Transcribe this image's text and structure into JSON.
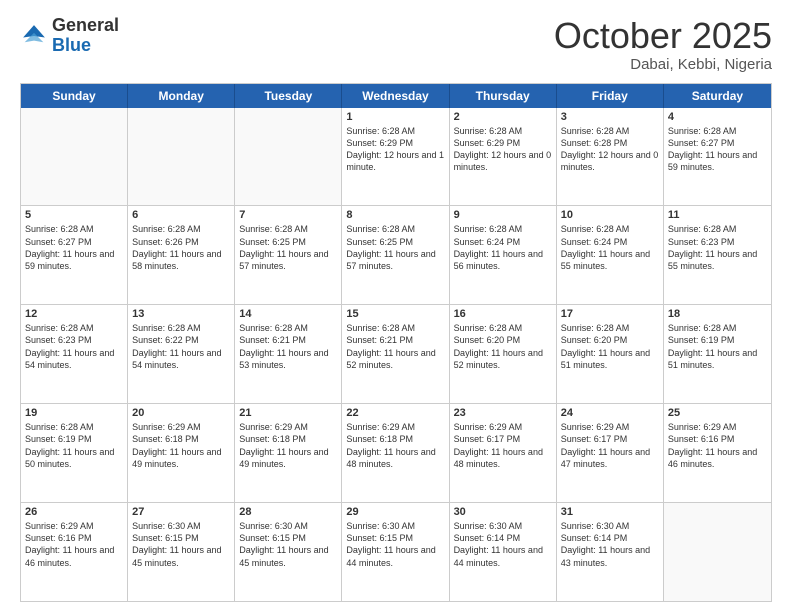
{
  "header": {
    "logo_general": "General",
    "logo_blue": "Blue",
    "month": "October 2025",
    "location": "Dabai, Kebbi, Nigeria"
  },
  "days_of_week": [
    "Sunday",
    "Monday",
    "Tuesday",
    "Wednesday",
    "Thursday",
    "Friday",
    "Saturday"
  ],
  "weeks": [
    [
      {
        "day": "",
        "empty": true
      },
      {
        "day": "",
        "empty": true
      },
      {
        "day": "",
        "empty": true
      },
      {
        "day": "1",
        "sunrise": "6:28 AM",
        "sunset": "6:29 PM",
        "daylight": "12 hours and 1 minute."
      },
      {
        "day": "2",
        "sunrise": "6:28 AM",
        "sunset": "6:29 PM",
        "daylight": "12 hours and 0 minutes."
      },
      {
        "day": "3",
        "sunrise": "6:28 AM",
        "sunset": "6:28 PM",
        "daylight": "12 hours and 0 minutes."
      },
      {
        "day": "4",
        "sunrise": "6:28 AM",
        "sunset": "6:27 PM",
        "daylight": "11 hours and 59 minutes."
      }
    ],
    [
      {
        "day": "5",
        "sunrise": "6:28 AM",
        "sunset": "6:27 PM",
        "daylight": "11 hours and 59 minutes."
      },
      {
        "day": "6",
        "sunrise": "6:28 AM",
        "sunset": "6:26 PM",
        "daylight": "11 hours and 58 minutes."
      },
      {
        "day": "7",
        "sunrise": "6:28 AM",
        "sunset": "6:25 PM",
        "daylight": "11 hours and 57 minutes."
      },
      {
        "day": "8",
        "sunrise": "6:28 AM",
        "sunset": "6:25 PM",
        "daylight": "11 hours and 57 minutes."
      },
      {
        "day": "9",
        "sunrise": "6:28 AM",
        "sunset": "6:24 PM",
        "daylight": "11 hours and 56 minutes."
      },
      {
        "day": "10",
        "sunrise": "6:28 AM",
        "sunset": "6:24 PM",
        "daylight": "11 hours and 55 minutes."
      },
      {
        "day": "11",
        "sunrise": "6:28 AM",
        "sunset": "6:23 PM",
        "daylight": "11 hours and 55 minutes."
      }
    ],
    [
      {
        "day": "12",
        "sunrise": "6:28 AM",
        "sunset": "6:23 PM",
        "daylight": "11 hours and 54 minutes."
      },
      {
        "day": "13",
        "sunrise": "6:28 AM",
        "sunset": "6:22 PM",
        "daylight": "11 hours and 54 minutes."
      },
      {
        "day": "14",
        "sunrise": "6:28 AM",
        "sunset": "6:21 PM",
        "daylight": "11 hours and 53 minutes."
      },
      {
        "day": "15",
        "sunrise": "6:28 AM",
        "sunset": "6:21 PM",
        "daylight": "11 hours and 52 minutes."
      },
      {
        "day": "16",
        "sunrise": "6:28 AM",
        "sunset": "6:20 PM",
        "daylight": "11 hours and 52 minutes."
      },
      {
        "day": "17",
        "sunrise": "6:28 AM",
        "sunset": "6:20 PM",
        "daylight": "11 hours and 51 minutes."
      },
      {
        "day": "18",
        "sunrise": "6:28 AM",
        "sunset": "6:19 PM",
        "daylight": "11 hours and 51 minutes."
      }
    ],
    [
      {
        "day": "19",
        "sunrise": "6:28 AM",
        "sunset": "6:19 PM",
        "daylight": "11 hours and 50 minutes."
      },
      {
        "day": "20",
        "sunrise": "6:29 AM",
        "sunset": "6:18 PM",
        "daylight": "11 hours and 49 minutes."
      },
      {
        "day": "21",
        "sunrise": "6:29 AM",
        "sunset": "6:18 PM",
        "daylight": "11 hours and 49 minutes."
      },
      {
        "day": "22",
        "sunrise": "6:29 AM",
        "sunset": "6:18 PM",
        "daylight": "11 hours and 48 minutes."
      },
      {
        "day": "23",
        "sunrise": "6:29 AM",
        "sunset": "6:17 PM",
        "daylight": "11 hours and 48 minutes."
      },
      {
        "day": "24",
        "sunrise": "6:29 AM",
        "sunset": "6:17 PM",
        "daylight": "11 hours and 47 minutes."
      },
      {
        "day": "25",
        "sunrise": "6:29 AM",
        "sunset": "6:16 PM",
        "daylight": "11 hours and 46 minutes."
      }
    ],
    [
      {
        "day": "26",
        "sunrise": "6:29 AM",
        "sunset": "6:16 PM",
        "daylight": "11 hours and 46 minutes."
      },
      {
        "day": "27",
        "sunrise": "6:30 AM",
        "sunset": "6:15 PM",
        "daylight": "11 hours and 45 minutes."
      },
      {
        "day": "28",
        "sunrise": "6:30 AM",
        "sunset": "6:15 PM",
        "daylight": "11 hours and 45 minutes."
      },
      {
        "day": "29",
        "sunrise": "6:30 AM",
        "sunset": "6:15 PM",
        "daylight": "11 hours and 44 minutes."
      },
      {
        "day": "30",
        "sunrise": "6:30 AM",
        "sunset": "6:14 PM",
        "daylight": "11 hours and 44 minutes."
      },
      {
        "day": "31",
        "sunrise": "6:30 AM",
        "sunset": "6:14 PM",
        "daylight": "11 hours and 43 minutes."
      },
      {
        "day": "",
        "empty": true
      }
    ]
  ],
  "labels": {
    "sunrise": "Sunrise:",
    "sunset": "Sunset:",
    "daylight": "Daylight:"
  }
}
